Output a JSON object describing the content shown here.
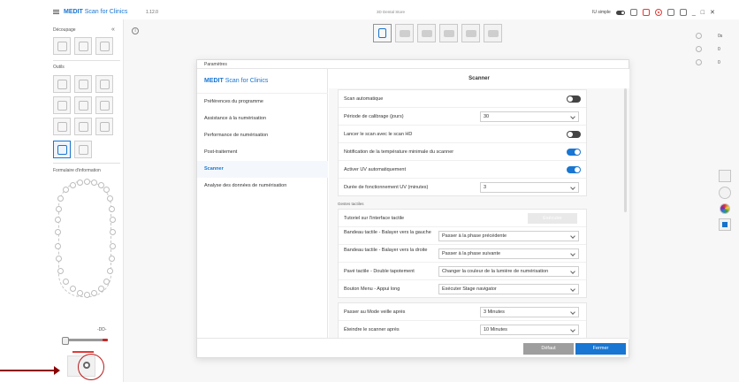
{
  "titlebar": {
    "brand": "MEDIT",
    "app_name": "Scan for Clinics",
    "version": "1.12.0",
    "store": "3D Dental Store",
    "mode_label": "IU simple"
  },
  "sidebar": {
    "section_decoupage": "Découpage",
    "section_outils": "Outils",
    "section_formulaire": "Formulaire d'information",
    "tool_label": "-DD-"
  },
  "right_panel": {
    "time": "0s",
    "count_a": "0",
    "count_b": "0"
  },
  "dialog": {
    "title": "Paramètres",
    "brand": "MEDIT",
    "brand_rest": "Scan for Clinics",
    "menu": [
      {
        "label": "Préférences du programme"
      },
      {
        "label": "Assistance à la numérisation"
      },
      {
        "label": "Performance de numérisation"
      },
      {
        "label": "Post-traitement"
      },
      {
        "label": "Scanner"
      },
      {
        "label": "Analyse des données de numérisation"
      }
    ],
    "section_title": "Scanner",
    "scanner_rows": {
      "scan_auto": {
        "label": "Scan automatique",
        "on": false
      },
      "calibration": {
        "label": "Période de calibrage (jours)",
        "value": "30"
      },
      "hd": {
        "label": "Lancer le scan avec le scan HD",
        "on": false
      },
      "temp_notif": {
        "label": "Notification de la température minimale du scanner",
        "on": true
      },
      "uv_auto": {
        "label": "Activer UV automatiquement",
        "on": true
      },
      "uv_duration": {
        "label": "Durée de fonctionnement UV (minutes)",
        "value": "3"
      }
    },
    "gestures_label": "Gestes tactiles",
    "gestures": {
      "tutorial": {
        "label": "Tutoriel sur l'interface tactile",
        "button": "Exécuter"
      },
      "swipe_left": {
        "label": "Bandeau tactile - Balayer vers la gauche",
        "value": "Passer à la phase précédente"
      },
      "swipe_right": {
        "label": "Bandeau tactile - Balayer vers la droite",
        "value": "Passer à la phase suivante"
      },
      "double_tap": {
        "label": "Pavé tactile - Double tapotement",
        "value": "Changer la couleur de la lumière de numérisation"
      },
      "menu_long": {
        "label": "Bouton Menu - Appui long",
        "value": "Exécuter Stage navigator"
      }
    },
    "power": {
      "sleep": {
        "label": "Passer au Mode veille après",
        "value": "3 Minutes"
      },
      "off": {
        "label": "Éteindre le scanner après",
        "value": "10 Minutes"
      }
    },
    "footer": {
      "default": "Défaut",
      "close": "Fermer"
    }
  },
  "colors": {
    "accent": "#1976d2",
    "annotation": "#8b0000"
  }
}
